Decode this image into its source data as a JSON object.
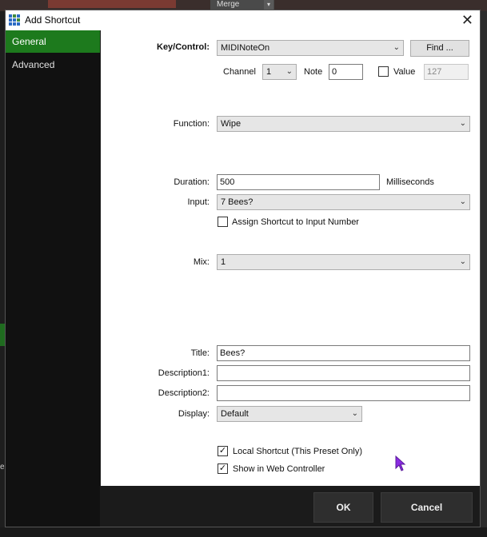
{
  "background": {
    "merge_label": "Merge",
    "merge_arrow": "▾",
    "left_fragment": "e"
  },
  "dialog": {
    "title": "Add Shortcut",
    "close_glyph": "✕"
  },
  "sidebar": {
    "items": [
      {
        "label": "General",
        "active": true
      },
      {
        "label": "Advanced",
        "active": false
      }
    ]
  },
  "form": {
    "key_control": {
      "label": "Key/Control:",
      "value": "MIDINoteOn",
      "find_button": "Find ..."
    },
    "channel": {
      "label": "Channel",
      "value": "1"
    },
    "note": {
      "label": "Note",
      "value": "0"
    },
    "value": {
      "label": "Value",
      "value": "127",
      "checked": false
    },
    "function": {
      "label": "Function:",
      "value": "Wipe"
    },
    "duration": {
      "label": "Duration:",
      "value": "500",
      "unit": "Milliseconds"
    },
    "input": {
      "label": "Input:",
      "value": "7 Bees?"
    },
    "assign_input_number": {
      "label": "Assign Shortcut to Input Number",
      "checked": false
    },
    "mix": {
      "label": "Mix:",
      "value": "1"
    },
    "title": {
      "label": "Title:",
      "value": "Bees?"
    },
    "description1": {
      "label": "Description1:",
      "value": ""
    },
    "description2": {
      "label": "Description2:",
      "value": ""
    },
    "display": {
      "label": "Display:",
      "value": "Default"
    },
    "local_shortcut": {
      "label": "Local Shortcut (This Preset Only)",
      "checked": true
    },
    "show_web_controller": {
      "label": "Show in Web Controller",
      "checked": true
    }
  },
  "footer": {
    "ok": "OK",
    "cancel": "Cancel"
  },
  "icons": {
    "chevron": "⌄",
    "check": "✓"
  },
  "colors": {
    "active_nav": "#1d7a1d",
    "cursor": "#8a2be2"
  }
}
